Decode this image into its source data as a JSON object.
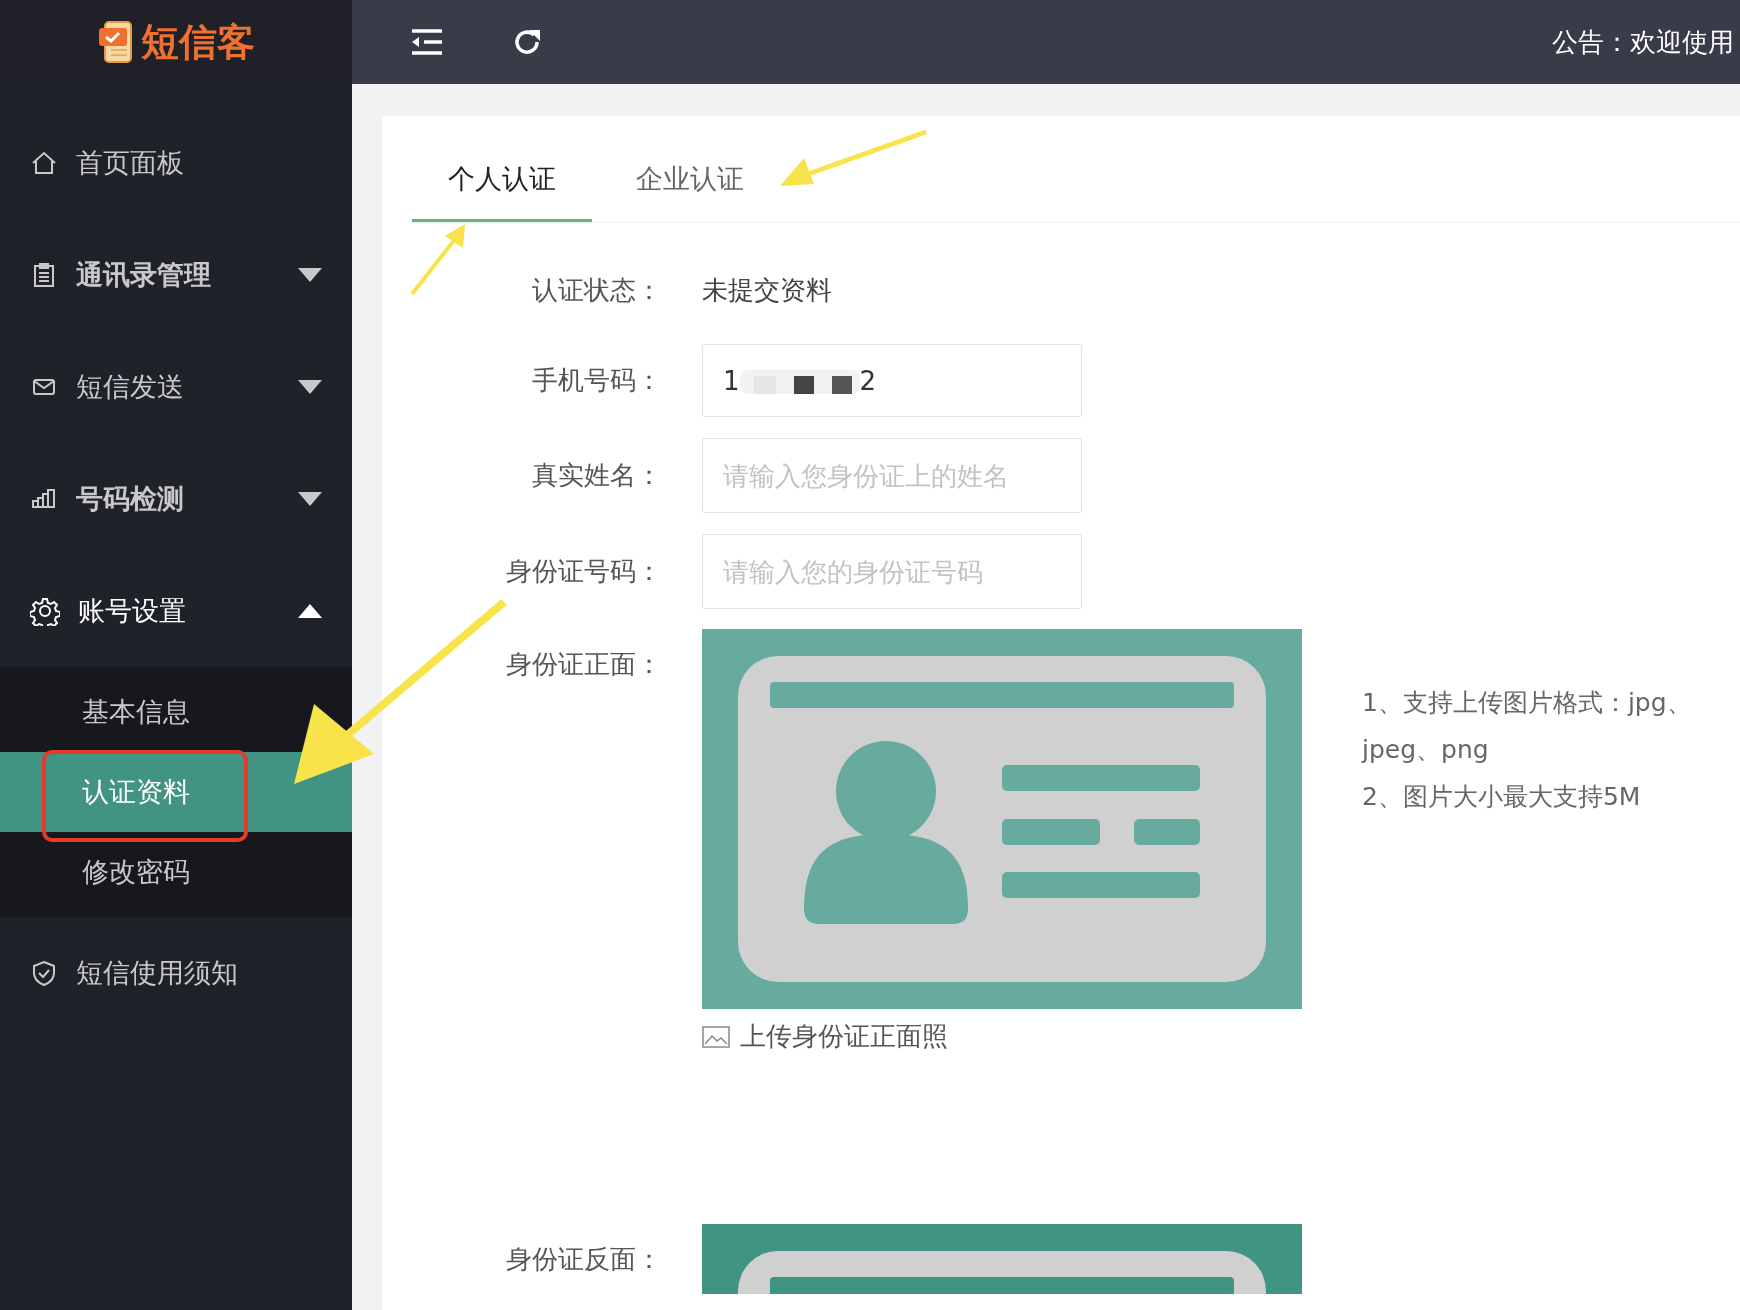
{
  "logo": {
    "text": "短信客"
  },
  "topbar": {
    "announcement": "公告：欢迎使用"
  },
  "sidebar": {
    "items": [
      {
        "label": "首页面板",
        "expanded": false,
        "has_children": false
      },
      {
        "label": "通讯录管理",
        "expanded": false,
        "has_children": true,
        "bold": true
      },
      {
        "label": "短信发送",
        "expanded": false,
        "has_children": true
      },
      {
        "label": "号码检测",
        "expanded": false,
        "has_children": true,
        "bold": true
      },
      {
        "label": "账号设置",
        "expanded": true,
        "has_children": true,
        "children": [
          {
            "label": "基本信息",
            "selected": false
          },
          {
            "label": "认证资料",
            "selected": true
          },
          {
            "label": "修改密码",
            "selected": false
          }
        ]
      },
      {
        "label": "短信使用须知",
        "expanded": false,
        "has_children": false
      }
    ]
  },
  "tabs": [
    {
      "label": "个人认证",
      "selected": true
    },
    {
      "label": "企业认证",
      "selected": false
    }
  ],
  "form": {
    "status_label": "认证状态：",
    "status_value": "未提交资料",
    "fields": [
      {
        "label": "手机号码：",
        "value_start": "1",
        "value_end": "2"
      },
      {
        "label": "真实姓名：",
        "placeholder": "请输入您身份证上的姓名"
      },
      {
        "label": "身份证号码：",
        "placeholder": "请输入您的身份证号码"
      }
    ],
    "uploads": [
      {
        "label": "身份证正面：",
        "caption": "上传身份证正面照",
        "hints": [
          "1、支持上传图片格式：jpg、jpeg、png",
          "2、图片大小最大支持5M"
        ]
      },
      {
        "label": "身份证反面："
      }
    ]
  }
}
